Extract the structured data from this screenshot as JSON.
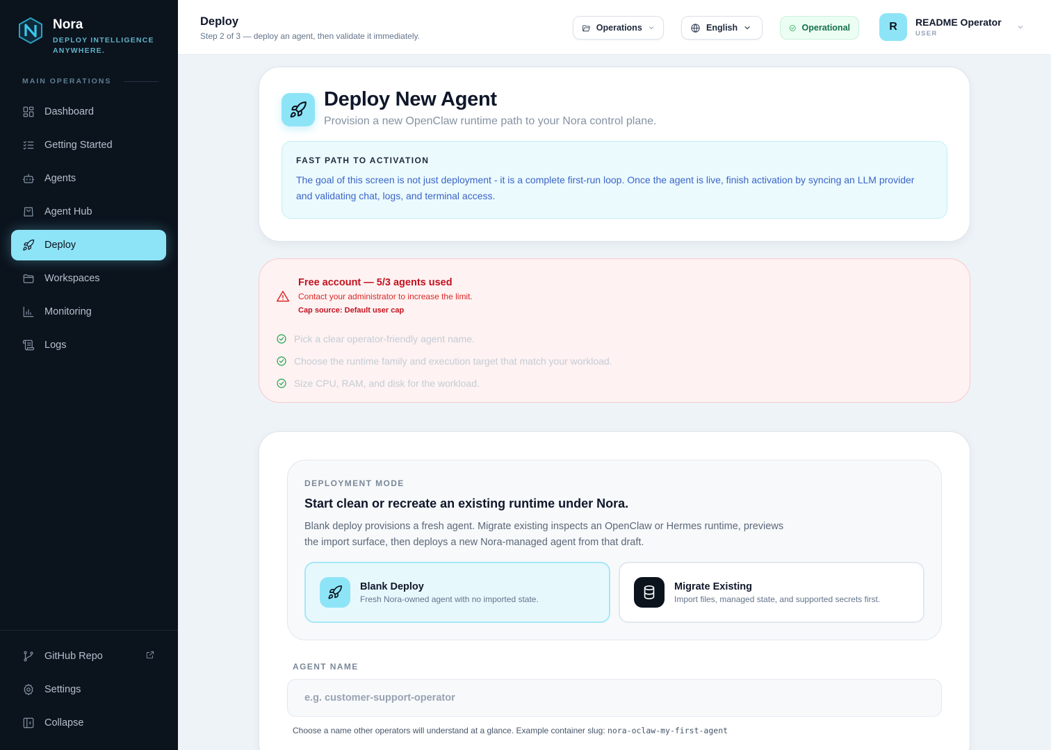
{
  "sidebar": {
    "brand_name": "Nora",
    "brand_tagline": "DEPLOY INTELLIGENCE ANYWHERE.",
    "section_label": "MAIN OPERATIONS",
    "items": [
      {
        "label": "Dashboard",
        "icon": "dashboard-icon"
      },
      {
        "label": "Getting Started",
        "icon": "checklist-icon"
      },
      {
        "label": "Agents",
        "icon": "bot-icon"
      },
      {
        "label": "Agent Hub",
        "icon": "shopping-bag-icon"
      },
      {
        "label": "Deploy",
        "icon": "rocket-icon",
        "active": true
      },
      {
        "label": "Workspaces",
        "icon": "folder-icon"
      },
      {
        "label": "Monitoring",
        "icon": "bar-chart-icon"
      },
      {
        "label": "Logs",
        "icon": "scroll-icon"
      }
    ],
    "bottom": {
      "github": "GitHub Repo",
      "settings": "Settings",
      "collapse": "Collapse"
    }
  },
  "header": {
    "title": "Deploy",
    "subtitle": "Step 2 of 3 — deploy an agent, then validate it immediately.",
    "operations_label": "Operations",
    "language_label": "English",
    "status_label": "Operational",
    "user_initial": "R",
    "user_name": "README Operator",
    "user_role": "USER"
  },
  "hero": {
    "title": "Deploy New Agent",
    "subtitle": "Provision a new OpenClaw runtime path to your Nora control plane.",
    "fastpath_label": "FAST PATH TO ACTIVATION",
    "fastpath_text": "The goal of this screen is not just deployment - it is a complete first-run loop. Once the agent is live, finish activation by syncing an LLM provider and validating chat, logs, and terminal access."
  },
  "limit": {
    "title": "Free account — 5/3 agents used",
    "contact": "Contact your administrator to increase the limit.",
    "cap_source": "Cap source: Default user cap",
    "checklist": [
      "Pick a clear operator-friendly agent name.",
      "Choose the runtime family and execution target that match your workload.",
      "Size CPU, RAM, and disk for the workload."
    ]
  },
  "mode": {
    "label": "DEPLOYMENT MODE",
    "title": "Start clean or recreate an existing runtime under Nora.",
    "description": "Blank deploy provisions a fresh agent. Migrate existing inspects an OpenClaw or Hermes runtime, previews the import surface, then deploys a new Nora-managed agent from that draft.",
    "options": [
      {
        "title": "Blank Deploy",
        "desc": "Fresh Nora-owned agent with no imported state.",
        "selected": true
      },
      {
        "title": "Migrate Existing",
        "desc": "Import files, managed state, and supported secrets first.",
        "selected": false
      }
    ]
  },
  "agent_name": {
    "label": "AGENT NAME",
    "placeholder": "e.g. customer-support-operator",
    "value": "",
    "hint": "Choose a name other operators will understand at a glance. Example container slug:",
    "slug_example": "nora-oclaw-my-first-agent"
  },
  "colors": {
    "accent": "#8ee4f7",
    "sidebar_bg": "#0b131d",
    "danger": "#dc2626",
    "success": "#16a34a"
  }
}
